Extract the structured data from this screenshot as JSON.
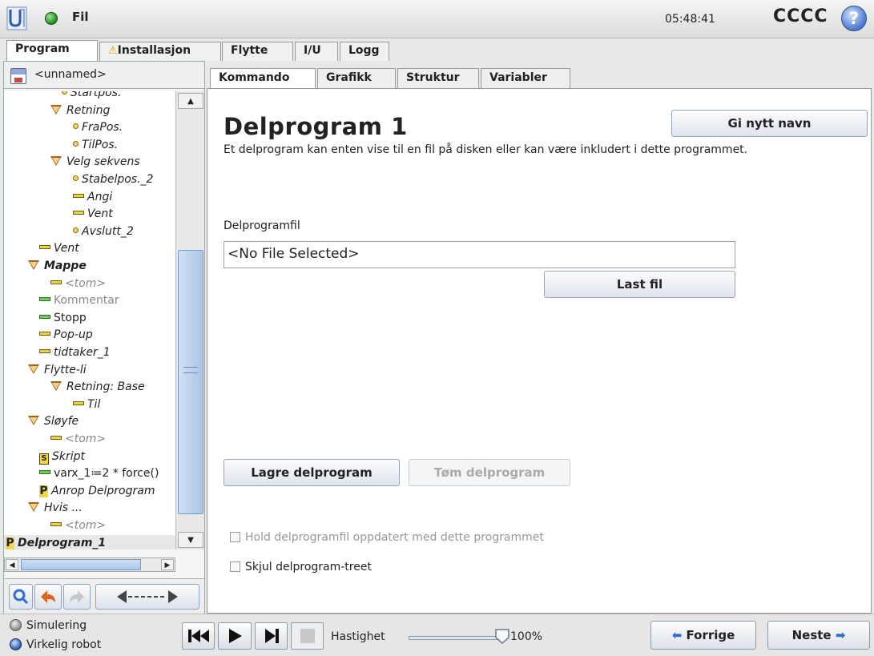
{
  "header": {
    "file_menu": "Fil",
    "clock": "05:48:41",
    "robot_name": "CCCC",
    "help": "?"
  },
  "main_tabs": [
    "Program",
    "Installasjon",
    "Flytte",
    "I/U",
    "Logg"
  ],
  "program": {
    "name": "<unnamed>"
  },
  "tree": [
    {
      "label": "Startpos.",
      "marker": "dot",
      "italic": true,
      "dim": false
    },
    {
      "label": "Retning",
      "marker": "tri",
      "italic": true,
      "dim": false
    },
    {
      "label": "FraPos.",
      "marker": "dot",
      "italic": true,
      "dim": false
    },
    {
      "label": "TilPos.",
      "marker": "dot",
      "italic": true,
      "dim": false
    },
    {
      "label": "Velg sekvens",
      "marker": "tri",
      "italic": true,
      "dim": false
    },
    {
      "label": "Stabelpos._2",
      "marker": "dot",
      "italic": true,
      "dim": false
    },
    {
      "label": "Angi",
      "marker": "dash",
      "italic": true,
      "dim": false
    },
    {
      "label": "Vent",
      "marker": "dash",
      "italic": true,
      "dim": false
    },
    {
      "label": "Avslutt_2",
      "marker": "dot",
      "italic": true,
      "dim": false
    },
    {
      "label": "Vent",
      "marker": "dash",
      "italic": true,
      "dim": false
    },
    {
      "label": "Mappe",
      "marker": "tri",
      "italic": true,
      "dim": false,
      "bold": true
    },
    {
      "label": "<tom>",
      "marker": "dash",
      "italic": true,
      "dim": true
    },
    {
      "label": "Kommentar",
      "marker": "dash-green",
      "italic": false,
      "dim": true
    },
    {
      "label": "Stopp",
      "marker": "dash-green",
      "italic": false,
      "dim": false
    },
    {
      "label": "Pop-up",
      "marker": "dash",
      "italic": true,
      "dim": false
    },
    {
      "label": "tidtaker_1",
      "marker": "dash",
      "italic": true,
      "dim": false
    },
    {
      "label": "Flytte-li",
      "marker": "tri",
      "italic": true,
      "dim": false
    },
    {
      "label": "Retning: Base",
      "marker": "tri",
      "italic": true,
      "dim": false
    },
    {
      "label": "Til",
      "marker": "dash",
      "italic": true,
      "dim": false
    },
    {
      "label": "Sløyfe",
      "marker": "tri",
      "italic": true,
      "dim": false
    },
    {
      "label": "<tom>",
      "marker": "dash",
      "italic": true,
      "dim": true
    },
    {
      "label": "Skript",
      "marker": "script",
      "italic": true,
      "dim": false
    },
    {
      "label": "varx_1≔2 * force()",
      "marker": "dash-green",
      "italic": false,
      "dim": false
    },
    {
      "label": "Anrop Delprogram",
      "marker": "p",
      "italic": true,
      "dim": false
    },
    {
      "label": "Hvis ...",
      "marker": "tri",
      "italic": true,
      "dim": false
    },
    {
      "label": "<tom>",
      "marker": "dash",
      "italic": true,
      "dim": true
    },
    {
      "label": "Delprogram_1",
      "marker": "p",
      "italic": true,
      "dim": false,
      "bold": true,
      "selected": true
    }
  ],
  "sub_tabs": [
    "Kommando",
    "Grafikk",
    "Struktur",
    "Variabler"
  ],
  "main": {
    "title": "Delprogram 1",
    "rename_button": "Gi nytt navn",
    "description": "Et delprogram kan enten vise til en fil på disken eller kan være inkludert i dette programmet.",
    "file_label": "Delprogramfil",
    "file_value": "<No File Selected>",
    "load_button": "Last fil",
    "save_button": "Lagre delprogram",
    "clear_button": "Tøm delprogram",
    "keep_updated_label": "Hold delprogramfil oppdatert med dette programmet",
    "hide_tree_label": "Skjul delprogram-treet"
  },
  "footer": {
    "simulation": "Simulering",
    "real_robot": "Virkelig robot",
    "speed_label": "Hastighet",
    "speed_value": "100%",
    "speed_fraction": 1.0,
    "prev": "Forrige",
    "next": "Neste"
  },
  "colors": {
    "accent": "#2f6fd0",
    "active_green": "#2c9a2c"
  }
}
